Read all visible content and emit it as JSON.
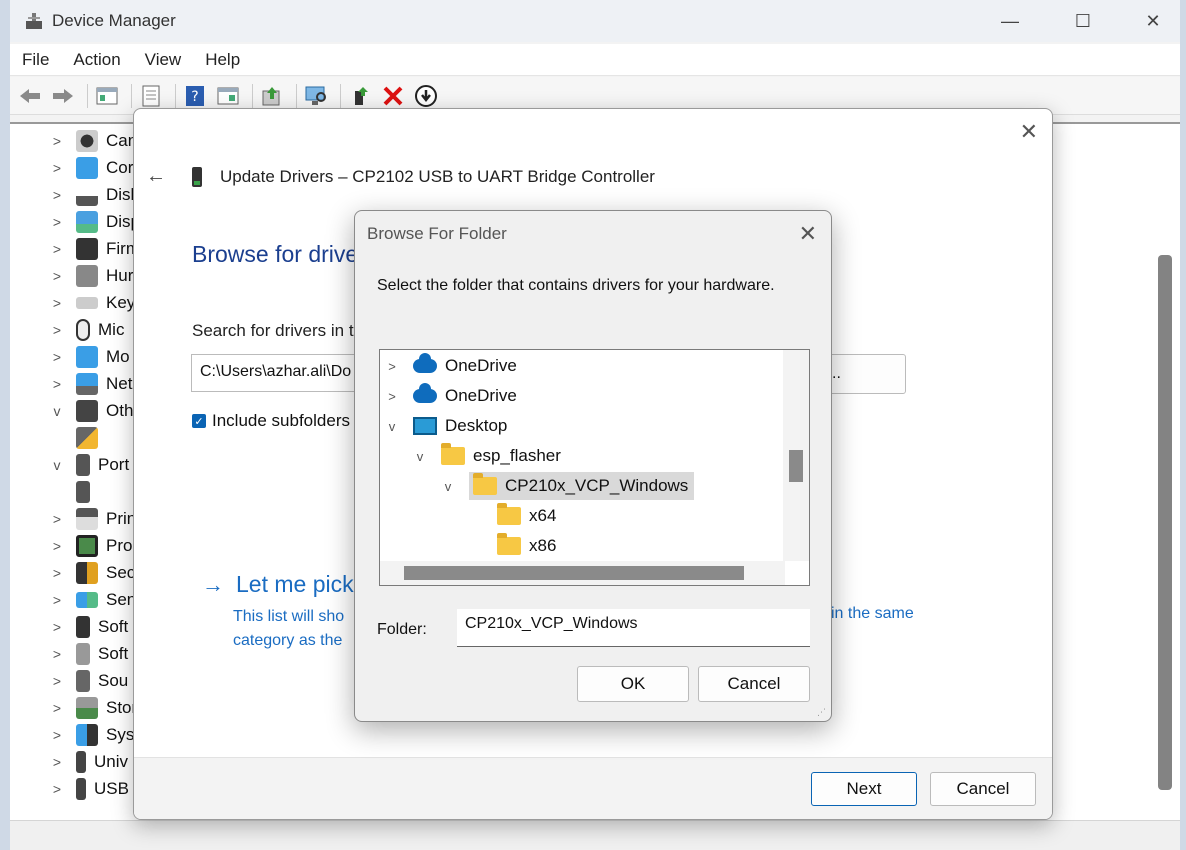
{
  "window": {
    "title": "Device Manager",
    "controls": {
      "minimize": "—",
      "maximize": "☐",
      "close": "✕"
    }
  },
  "menubar": [
    "File",
    "Action",
    "View",
    "Help"
  ],
  "toolbar_icons": [
    "back-icon",
    "forward-icon",
    "show-hide-console-tree-icon",
    "properties-icon",
    "help-icon",
    "action-pane-icon",
    "update-driver-icon",
    "scan-hardware-icon",
    "enable-device-icon",
    "uninstall-device-icon",
    "disable-device-icon"
  ],
  "device_tree": [
    {
      "label": "Can",
      "chevron": ">"
    },
    {
      "label": "Cor",
      "chevron": ">"
    },
    {
      "label": "Disk",
      "chevron": ">"
    },
    {
      "label": "Disp",
      "chevron": ">"
    },
    {
      "label": "Firm",
      "chevron": ">"
    },
    {
      "label": "Hur",
      "chevron": ">"
    },
    {
      "label": "Key",
      "chevron": ">"
    },
    {
      "label": "Mic",
      "chevron": ">"
    },
    {
      "label": "Mo",
      "chevron": ">"
    },
    {
      "label": "Net",
      "chevron": ">"
    },
    {
      "label": "Oth",
      "chevron": "v"
    },
    {
      "label": "",
      "chevron": ""
    },
    {
      "label": "Port",
      "chevron": "v"
    },
    {
      "label": "",
      "chevron": ""
    },
    {
      "label": "Prin",
      "chevron": ">"
    },
    {
      "label": "Proc",
      "chevron": ">"
    },
    {
      "label": "Secu",
      "chevron": ">"
    },
    {
      "label": "Sen",
      "chevron": ">"
    },
    {
      "label": "Soft",
      "chevron": ">"
    },
    {
      "label": "Soft",
      "chevron": ">"
    },
    {
      "label": "Sou",
      "chevron": ">"
    },
    {
      "label": "Stor",
      "chevron": ">"
    },
    {
      "label": "Syst",
      "chevron": ">"
    },
    {
      "label": "Univ",
      "chevron": ">"
    },
    {
      "label": "USB",
      "chevron": ">"
    }
  ],
  "wizard": {
    "close": "✕",
    "back": "←",
    "title": "Update Drivers – CP2102 USB to UART Bridge Controller",
    "heading": "Browse for drive",
    "search_label": "Search for drivers in t",
    "path_value": "C:\\Users\\azhar.ali\\Do",
    "browse_label": "wse...",
    "include_subfolders": "Include subfolders",
    "pick_arrow": "→",
    "pick_heading": "Let me pick",
    "pick_desc_line1": "This list will sho",
    "pick_desc_line2": "category as the",
    "pick_desc_right": "in the same",
    "next_label": "Next",
    "cancel_label": "Cancel"
  },
  "browse_folder": {
    "title": "Browse For Folder",
    "close": "✕",
    "instruction": "Select the folder that contains drivers for your hardware.",
    "tree": [
      {
        "label": "OneDrive",
        "chevron": ">",
        "icon": "onedrive-icon"
      },
      {
        "label": "OneDrive",
        "chevron": ">",
        "icon": "onedrive-icon"
      },
      {
        "label": "Desktop",
        "chevron": "v",
        "icon": "desktop-icon"
      },
      {
        "label": "esp_flasher",
        "chevron": "v",
        "icon": "folder-icon"
      },
      {
        "label": "CP210x_VCP_Windows",
        "chevron": "v",
        "icon": "folder-icon",
        "selected": true
      },
      {
        "label": "x64",
        "chevron": "",
        "icon": "folder-icon"
      },
      {
        "label": "x86",
        "chevron": "",
        "icon": "folder-icon"
      }
    ],
    "folder_label": "Folder:",
    "folder_value": "CP210x_VCP_Windows",
    "ok_label": "OK",
    "cancel_label": "Cancel"
  }
}
